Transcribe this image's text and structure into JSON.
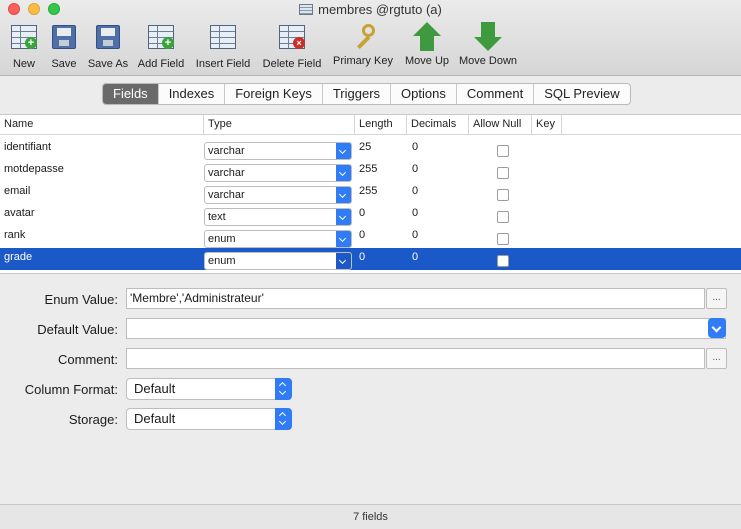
{
  "window": {
    "title": "membres @rgtuto (a)"
  },
  "toolbar": {
    "items": [
      {
        "label": "New",
        "icon": "new-table-icon"
      },
      {
        "label": "Save",
        "icon": "save-disk-icon"
      },
      {
        "label": "Save As",
        "icon": "save-as-icon"
      },
      {
        "label": "Add Field",
        "icon": "add-field-icon"
      },
      {
        "label": "Insert Field",
        "icon": "insert-field-icon"
      },
      {
        "label": "Delete Field",
        "icon": "delete-field-icon"
      },
      {
        "label": "Primary Key",
        "icon": "key-icon"
      },
      {
        "label": "Move Up",
        "icon": "arrow-up-icon"
      },
      {
        "label": "Move Down",
        "icon": "arrow-down-icon"
      }
    ]
  },
  "tabs": [
    "Fields",
    "Indexes",
    "Foreign Keys",
    "Triggers",
    "Options",
    "Comment",
    "SQL Preview"
  ],
  "active_tab": "Fields",
  "grid": {
    "columns": [
      "Name",
      "Type",
      "Length",
      "Decimals",
      "Allow Null",
      "Key"
    ],
    "rows": [
      {
        "name": "identifiant",
        "type": "varchar",
        "length": "25",
        "decimals": "0",
        "allow_null": false
      },
      {
        "name": "motdepasse",
        "type": "varchar",
        "length": "255",
        "decimals": "0",
        "allow_null": false
      },
      {
        "name": "email",
        "type": "varchar",
        "length": "255",
        "decimals": "0",
        "allow_null": false
      },
      {
        "name": "avatar",
        "type": "text",
        "length": "0",
        "decimals": "0",
        "allow_null": false
      },
      {
        "name": "rank",
        "type": "enum",
        "length": "0",
        "decimals": "0",
        "allow_null": false
      },
      {
        "name": "grade",
        "type": "enum",
        "length": "0",
        "decimals": "0",
        "allow_null": false,
        "selected": true
      }
    ]
  },
  "form": {
    "enum_value_label": "Enum Value:",
    "enum_value": "'Membre','Administrateur'",
    "enum_button": "...",
    "default_value_label": "Default Value:",
    "default_value": "",
    "comment_label": "Comment:",
    "comment": "",
    "comment_button": "...",
    "column_format_label": "Column Format:",
    "column_format": "Default",
    "storage_label": "Storage:",
    "storage": "Default"
  },
  "status": {
    "text": "7 fields"
  },
  "colors": {
    "selection": "#1c59c8",
    "accent": "#2f7cf6"
  }
}
